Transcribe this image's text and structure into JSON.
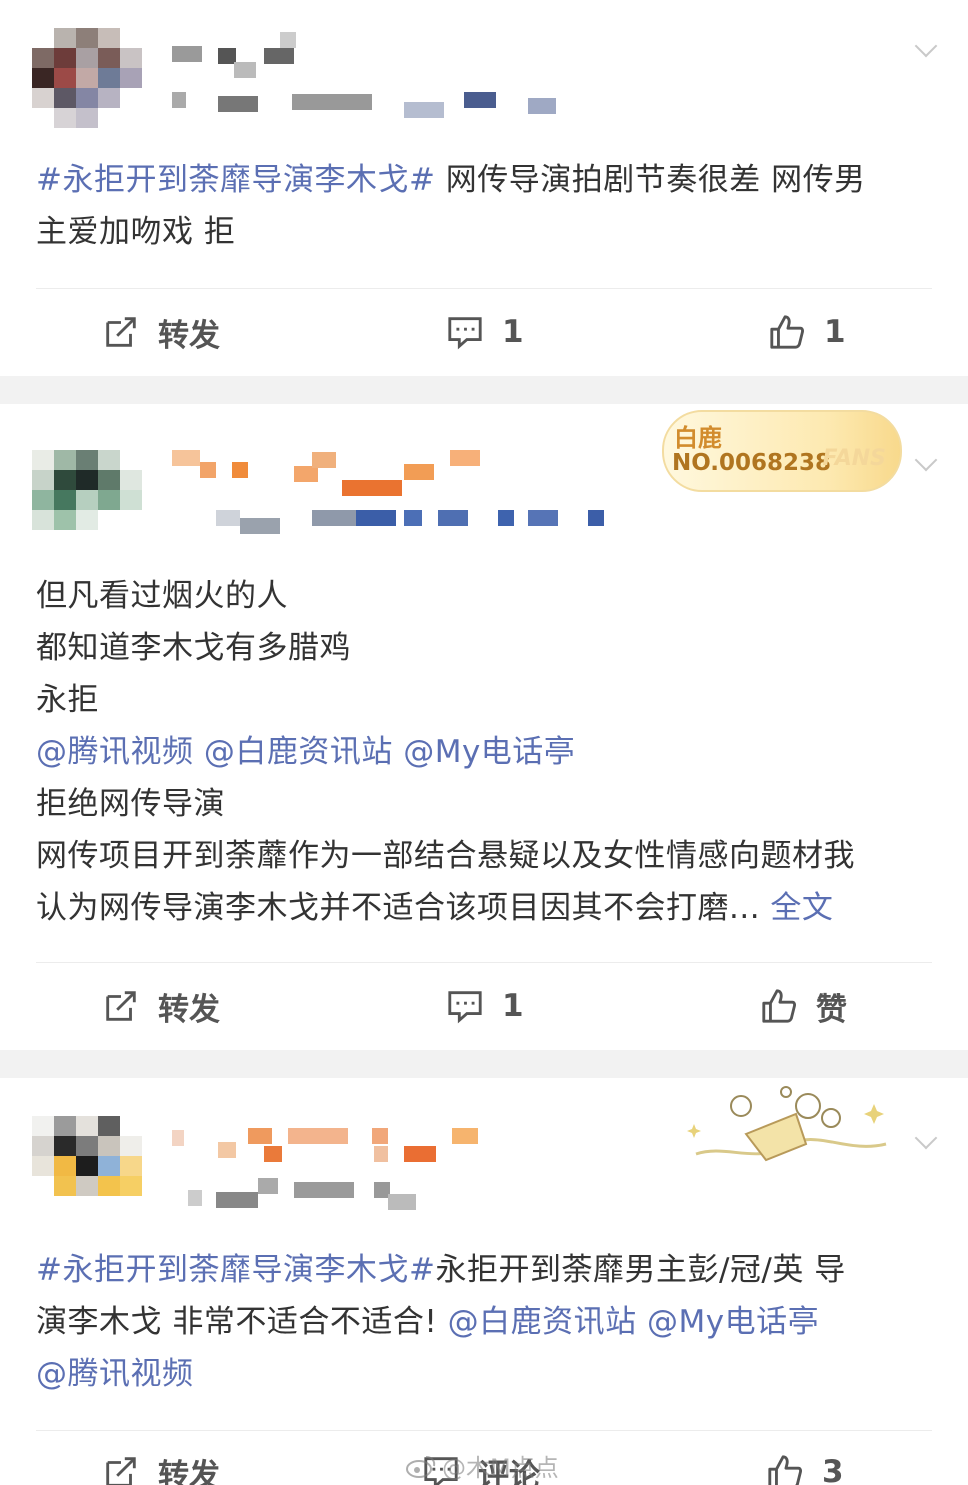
{
  "posts": [
    {
      "text_lines": [
        [
          {
            "t": "#永拒开到荼靡导演李木戈#",
            "link": true
          },
          {
            "t": " 网传导演拍剧节奏很差 网传男",
            "link": false
          }
        ],
        [
          {
            "t": "主爱加吻戏 拒",
            "link": false
          }
        ]
      ],
      "actions": {
        "repost_label": "转发",
        "comment_count": "1",
        "like_count": "1"
      }
    },
    {
      "badge": {
        "name": "白鹿",
        "number": "NO.0068238",
        "fans": "FANS"
      },
      "text_lines": [
        [
          {
            "t": "但凡看过烟火的人",
            "link": false
          }
        ],
        [
          {
            "t": "都知道李木戈有多腊鸡",
            "link": false
          }
        ],
        [
          {
            "t": "永拒",
            "link": false
          }
        ],
        [
          {
            "t": "@腾讯视频 @白鹿资讯站 @My电话亭",
            "link": true
          }
        ],
        [
          {
            "t": "拒绝网传导演",
            "link": false
          }
        ],
        [
          {
            "t": "网传项目开到荼蘼作为一部结合悬疑以及女性情感向题材我",
            "link": false
          }
        ],
        [
          {
            "t": "认为网传导演李木戈并不适合该项目因其不会打磨... ",
            "link": false
          },
          {
            "t": "全文",
            "link": true
          }
        ]
      ],
      "actions": {
        "repost_label": "转发",
        "comment_count": "1",
        "like_count": "赞"
      }
    },
    {
      "text_lines": [
        [
          {
            "t": "#永拒开到荼靡导演李木戈#",
            "link": true
          },
          {
            "t": "永拒开到荼靡男主彭/冠/英 导",
            "link": false
          }
        ],
        [
          {
            "t": "演李木戈 非常不适合不适合! ",
            "link": false
          },
          {
            "t": "@白鹿资讯站 @My电话亭",
            "link": true
          }
        ],
        [
          {
            "t": "@腾讯视频",
            "link": true
          }
        ]
      ],
      "actions": {
        "repost_label": "转发",
        "comment_count": "评论",
        "like_count": "3"
      }
    }
  ],
  "watermark": "@木M点点",
  "colors": {
    "link": "#5b6fb3",
    "text": "#333333",
    "separator": "#f2f2f2"
  },
  "icons": [
    "repost-icon",
    "comment-icon",
    "like-icon",
    "chevron-down-icon",
    "weibo-logo-icon"
  ]
}
